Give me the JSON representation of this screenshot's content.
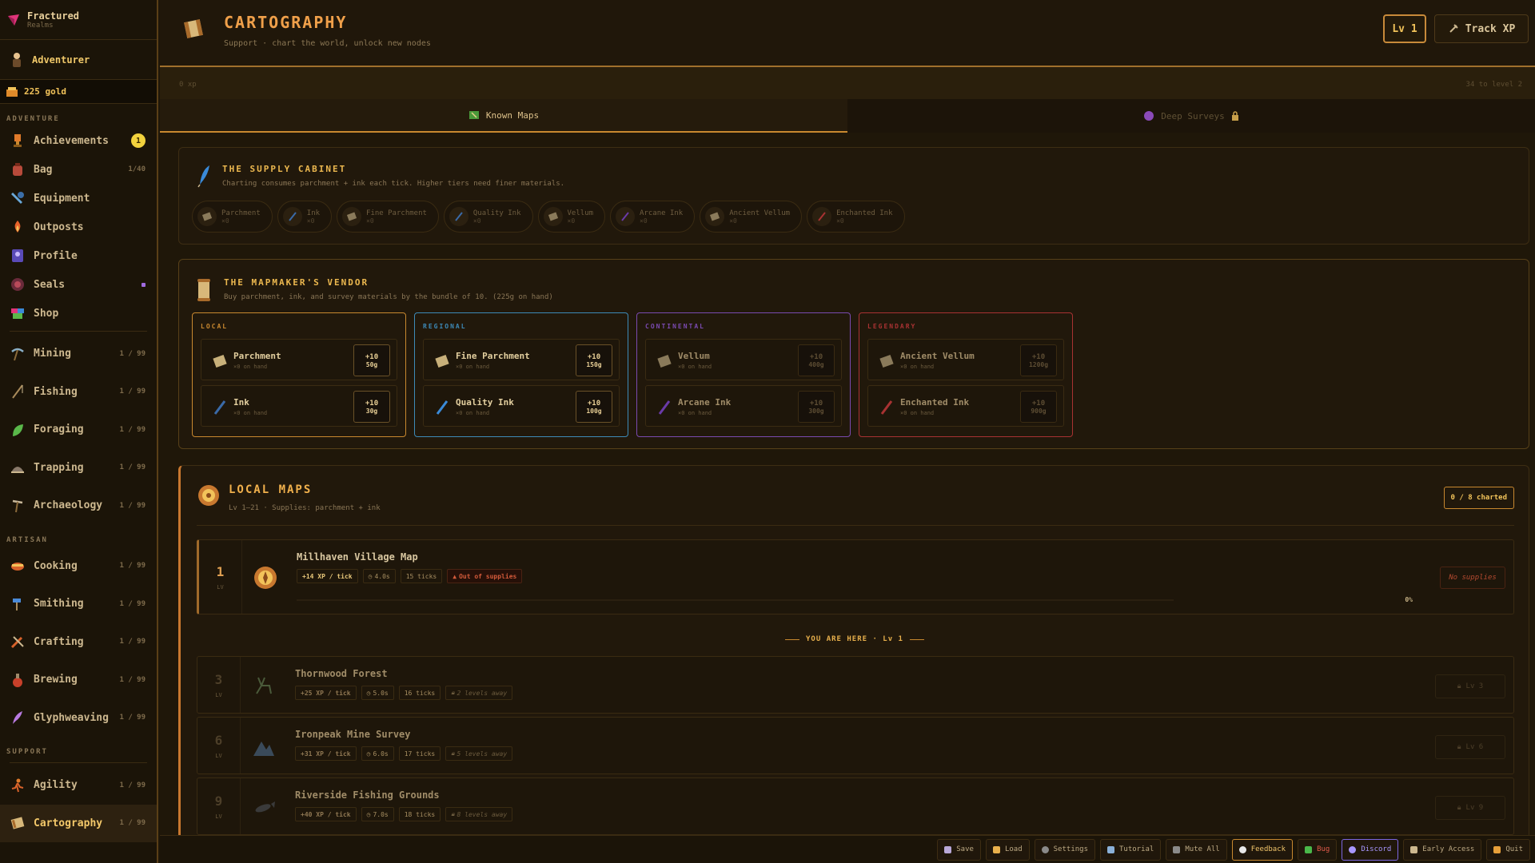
{
  "brand": {
    "name": "Fractured",
    "sub": "Realms"
  },
  "character": {
    "name": "Adventurer"
  },
  "gold": {
    "label": "225 gold"
  },
  "sidebar": {
    "adventure_label": "ADVENTURE",
    "adventure": [
      {
        "label": "Achievements",
        "badge": "1"
      },
      {
        "label": "Bag",
        "count": "1/40"
      },
      {
        "label": "Equipment"
      },
      {
        "label": "Outposts"
      },
      {
        "label": "Profile"
      },
      {
        "label": "Seals"
      },
      {
        "label": "Shop"
      }
    ],
    "gathering": [
      {
        "label": "Mining",
        "count": "1 / 99"
      },
      {
        "label": "Fishing",
        "count": "1 / 99"
      },
      {
        "label": "Foraging",
        "count": "1 / 99"
      },
      {
        "label": "Trapping",
        "count": "1 / 99"
      },
      {
        "label": "Archaeology",
        "count": "1 / 99"
      }
    ],
    "artisan_label": "ARTISAN",
    "artisan": [
      {
        "label": "Cooking",
        "count": "1 / 99"
      },
      {
        "label": "Smithing",
        "count": "1 / 99"
      },
      {
        "label": "Crafting",
        "count": "1 / 99"
      },
      {
        "label": "Brewing",
        "count": "1 / 99"
      },
      {
        "label": "Glyphweaving",
        "count": "1 / 99"
      }
    ],
    "support_label": "SUPPORT",
    "support": [
      {
        "label": "Agility",
        "count": "1 / 99"
      },
      {
        "label": "Cartography",
        "count": "1 / 99"
      }
    ]
  },
  "header": {
    "title": "CARTOGRAPHY",
    "subtitle": "Support · chart the world, unlock new nodes",
    "level": "Lv 1",
    "track_xp": "Track XP",
    "xp_left": "0 xp",
    "xp_right": "34 to level 2",
    "xp_progress": 0
  },
  "tabs": [
    {
      "label": "Known Maps",
      "active": true
    },
    {
      "label": "Deep Surveys",
      "locked": true
    }
  ],
  "supply": {
    "title": "THE SUPPLY CABINET",
    "desc": "Charting consumes parchment + ink each tick. Higher tiers need finer materials.",
    "items": [
      {
        "name": "Parchment",
        "qty": "×0"
      },
      {
        "name": "Ink",
        "qty": "×0"
      },
      {
        "name": "Fine Parchment",
        "qty": "×0"
      },
      {
        "name": "Quality Ink",
        "qty": "×0"
      },
      {
        "name": "Vellum",
        "qty": "×0"
      },
      {
        "name": "Arcane Ink",
        "qty": "×0"
      },
      {
        "name": "Ancient Vellum",
        "qty": "×0"
      },
      {
        "name": "Enchanted Ink",
        "qty": "×0"
      }
    ]
  },
  "vendor": {
    "title": "THE MAPMAKER'S VENDOR",
    "desc": "Buy parchment, ink, and survey materials by the bundle of 10. (225g on hand)",
    "tiers": [
      {
        "name": "LOCAL",
        "color": "#c8882f",
        "rows": [
          {
            "name": "Parchment",
            "hand": "×0 on hand",
            "qty": "+10",
            "price": "50g"
          },
          {
            "name": "Ink",
            "hand": "×0 on hand",
            "qty": "+10",
            "price": "30g"
          }
        ]
      },
      {
        "name": "REGIONAL",
        "color": "#3d8ab8",
        "rows": [
          {
            "name": "Fine Parchment",
            "hand": "×0 on hand",
            "qty": "+10",
            "price": "150g"
          },
          {
            "name": "Quality Ink",
            "hand": "×0 on hand",
            "qty": "+10",
            "price": "100g"
          }
        ]
      },
      {
        "name": "CONTINENTAL",
        "color": "#7a4ab0",
        "rows": [
          {
            "name": "Vellum",
            "hand": "×0 on hand",
            "qty": "+10",
            "price": "400g"
          },
          {
            "name": "Arcane Ink",
            "hand": "×0 on hand",
            "qty": "+10",
            "price": "300g"
          }
        ]
      },
      {
        "name": "LEGENDARY",
        "color": "#a83232",
        "rows": [
          {
            "name": "Ancient Vellum",
            "hand": "×0 on hand",
            "qty": "+10",
            "price": "1200g"
          },
          {
            "name": "Enchanted Ink",
            "hand": "×0 on hand",
            "qty": "+10",
            "price": "900g"
          }
        ]
      }
    ]
  },
  "maps": {
    "title": "LOCAL MAPS",
    "subtitle": "Lv 1–21 · Supplies: parchment + ink",
    "charted": "0 / 8 charted",
    "you_are_here": "YOU ARE HERE · Lv 1",
    "lv_label": "LV",
    "items": [
      {
        "lv": "1",
        "name": "Millhaven Village Map",
        "xp": "+14 XP / tick",
        "time": "4.0s",
        "ticks": "15 ticks",
        "status": "Out of supplies",
        "pct": "0%",
        "progress": 0,
        "action": "No supplies"
      },
      {
        "lv": "3",
        "name": "Thornwood Forest",
        "xp": "+25 XP / tick",
        "time": "5.0s",
        "ticks": "16 ticks",
        "status": "2 levels away",
        "action": "Lv 3"
      },
      {
        "lv": "6",
        "name": "Ironpeak Mine Survey",
        "xp": "+31 XP / tick",
        "time": "6.0s",
        "ticks": "17 ticks",
        "status": "5 levels away",
        "action": "Lv 6"
      },
      {
        "lv": "9",
        "name": "Riverside Fishing Grounds",
        "xp": "+40 XP / tick",
        "time": "7.0s",
        "ticks": "18 ticks",
        "status": "8 levels away",
        "action": "Lv 9"
      }
    ]
  },
  "footer": [
    "Save",
    "Load",
    "Settings",
    "Tutorial",
    "Mute All",
    "Feedback",
    "Bug",
    "Discord",
    "Early Access",
    "Quit"
  ]
}
